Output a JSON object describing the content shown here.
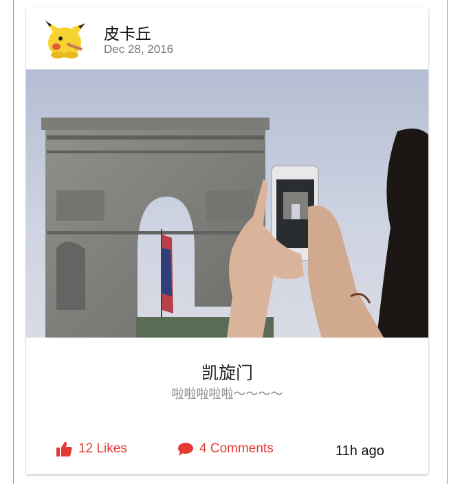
{
  "post": {
    "author": "皮卡丘",
    "date": "Dec 28, 2016",
    "title": "凯旋门",
    "subtitle": "啦啦啦啦啦～～～～",
    "likes_label": "12 Likes",
    "comments_label": "4 Comments",
    "time_ago": "11h ago"
  },
  "icons": {
    "like": "thumbs-up-icon",
    "comment": "speech-bubble-icon"
  },
  "colors": {
    "accent": "#e53935",
    "author_text": "#111111",
    "date_text": "#757575",
    "subtitle_text": "#888888"
  }
}
